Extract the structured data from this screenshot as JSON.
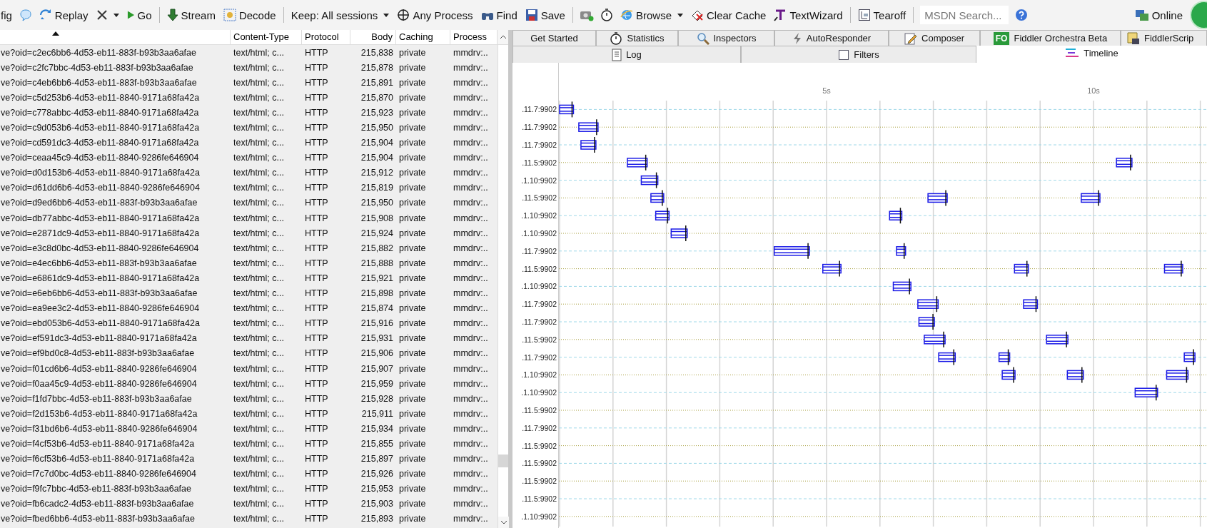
{
  "toolbar": [
    {
      "kind": "button",
      "label": "fig"
    },
    {
      "kind": "icon"
    },
    {
      "kind": "button",
      "label": "Replay"
    },
    {
      "kind": "icon",
      "has_menu": true
    },
    {
      "kind": "button",
      "label": "Go"
    },
    {
      "kind": "separator"
    },
    {
      "kind": "button",
      "label": "Stream"
    },
    {
      "kind": "button",
      "label": "Decode"
    },
    {
      "kind": "separator"
    },
    {
      "kind": "button",
      "label": "Keep: All sessions",
      "has_menu": true
    },
    {
      "kind": "button",
      "label": "Any Process"
    },
    {
      "kind": "button",
      "label": "Find"
    },
    {
      "kind": "button",
      "label": "Save"
    },
    {
      "kind": "separator"
    },
    {
      "kind": "icon"
    },
    {
      "kind": "icon"
    },
    {
      "kind": "button",
      "label": "Browse",
      "has_menu": true
    },
    {
      "kind": "button",
      "label": "Clear Cache"
    },
    {
      "kind": "button",
      "label": "TextWizard"
    },
    {
      "kind": "separator"
    },
    {
      "kind": "button",
      "label": "Tearoff"
    },
    {
      "kind": "separator"
    },
    {
      "kind": "search",
      "placeholder": "MSDN Search..."
    },
    {
      "kind": "icon"
    },
    {
      "kind": "spacer"
    },
    {
      "kind": "button",
      "label": "Online"
    }
  ],
  "sessions": {
    "columns": [
      "Content-Type",
      "Protocol",
      "Body",
      "Caching",
      "Process"
    ],
    "rows": [
      {
        "url": "ve?oid=c2ec6bb6-4d53-eb11-883f-b93b3aa6afae",
        "content_type": "text/html; c...",
        "protocol": "HTTP",
        "body": "215,838",
        "caching": "private",
        "process": "mmdrv:.."
      },
      {
        "url": "ve?oid=c2fc7bbc-4d53-eb11-883f-b93b3aa6afae",
        "content_type": "text/html; c...",
        "protocol": "HTTP",
        "body": "215,878",
        "caching": "private",
        "process": "mmdrv:.."
      },
      {
        "url": "ve?oid=c4eb6bb6-4d53-eb11-883f-b93b3aa6afae",
        "content_type": "text/html; c...",
        "protocol": "HTTP",
        "body": "215,891",
        "caching": "private",
        "process": "mmdrv:.."
      },
      {
        "url": "ve?oid=c5d253b6-4d53-eb11-8840-9171a68fa42a",
        "content_type": "text/html; c...",
        "protocol": "HTTP",
        "body": "215,870",
        "caching": "private",
        "process": "mmdrv:.."
      },
      {
        "url": "ve?oid=c778abbc-4d53-eb11-8840-9171a68fa42a",
        "content_type": "text/html; c...",
        "protocol": "HTTP",
        "body": "215,923",
        "caching": "private",
        "process": "mmdrv:.."
      },
      {
        "url": "ve?oid=c9d053b6-4d53-eb11-8840-9171a68fa42a",
        "content_type": "text/html; c...",
        "protocol": "HTTP",
        "body": "215,950",
        "caching": "private",
        "process": "mmdrv:.."
      },
      {
        "url": "ve?oid=cd591dc3-4d53-eb11-8840-9171a68fa42a",
        "content_type": "text/html; c...",
        "protocol": "HTTP",
        "body": "215,904",
        "caching": "private",
        "process": "mmdrv:.."
      },
      {
        "url": "ve?oid=ceaa45c9-4d53-eb11-8840-9286fe646904",
        "content_type": "text/html; c...",
        "protocol": "HTTP",
        "body": "215,904",
        "caching": "private",
        "process": "mmdrv:.."
      },
      {
        "url": "ve?oid=d0d153b6-4d53-eb11-8840-9171a68fa42a",
        "content_type": "text/html; c...",
        "protocol": "HTTP",
        "body": "215,912",
        "caching": "private",
        "process": "mmdrv:.."
      },
      {
        "url": "ve?oid=d61dd6b6-4d53-eb11-8840-9286fe646904",
        "content_type": "text/html; c...",
        "protocol": "HTTP",
        "body": "215,819",
        "caching": "private",
        "process": "mmdrv:.."
      },
      {
        "url": "ve?oid=d9ed6bb6-4d53-eb11-883f-b93b3aa6afae",
        "content_type": "text/html; c...",
        "protocol": "HTTP",
        "body": "215,950",
        "caching": "private",
        "process": "mmdrv:.."
      },
      {
        "url": "ve?oid=db77abbc-4d53-eb11-8840-9171a68fa42a",
        "content_type": "text/html; c...",
        "protocol": "HTTP",
        "body": "215,908",
        "caching": "private",
        "process": "mmdrv:.."
      },
      {
        "url": "ve?oid=e2871dc9-4d53-eb11-8840-9171a68fa42a",
        "content_type": "text/html; c...",
        "protocol": "HTTP",
        "body": "215,924",
        "caching": "private",
        "process": "mmdrv:.."
      },
      {
        "url": "ve?oid=e3c8d0bc-4d53-eb11-8840-9286fe646904",
        "content_type": "text/html; c...",
        "protocol": "HTTP",
        "body": "215,882",
        "caching": "private",
        "process": "mmdrv:.."
      },
      {
        "url": "ve?oid=e4ec6bb6-4d53-eb11-883f-b93b3aa6afae",
        "content_type": "text/html; c...",
        "protocol": "HTTP",
        "body": "215,888",
        "caching": "private",
        "process": "mmdrv:.."
      },
      {
        "url": "ve?oid=e6861dc9-4d53-eb11-8840-9171a68fa42a",
        "content_type": "text/html; c...",
        "protocol": "HTTP",
        "body": "215,921",
        "caching": "private",
        "process": "mmdrv:.."
      },
      {
        "url": "ve?oid=e6eb6bb6-4d53-eb11-883f-b93b3aa6afae",
        "content_type": "text/html; c...",
        "protocol": "HTTP",
        "body": "215,898",
        "caching": "private",
        "process": "mmdrv:.."
      },
      {
        "url": "ve?oid=ea9ee3c2-4d53-eb11-8840-9286fe646904",
        "content_type": "text/html; c...",
        "protocol": "HTTP",
        "body": "215,874",
        "caching": "private",
        "process": "mmdrv:.."
      },
      {
        "url": "ve?oid=ebd053b6-4d53-eb11-8840-9171a68fa42a",
        "content_type": "text/html; c...",
        "protocol": "HTTP",
        "body": "215,916",
        "caching": "private",
        "process": "mmdrv:.."
      },
      {
        "url": "ve?oid=ef591dc3-4d53-eb11-8840-9171a68fa42a",
        "content_type": "text/html; c...",
        "protocol": "HTTP",
        "body": "215,931",
        "caching": "private",
        "process": "mmdrv:.."
      },
      {
        "url": "ve?oid=ef9bd0c8-4d53-eb11-883f-b93b3aa6afae",
        "content_type": "text/html; c...",
        "protocol": "HTTP",
        "body": "215,906",
        "caching": "private",
        "process": "mmdrv:.."
      },
      {
        "url": "ve?oid=f01cd6b6-4d53-eb11-8840-9286fe646904",
        "content_type": "text/html; c...",
        "protocol": "HTTP",
        "body": "215,907",
        "caching": "private",
        "process": "mmdrv:.."
      },
      {
        "url": "ve?oid=f0aa45c9-4d53-eb11-8840-9286fe646904",
        "content_type": "text/html; c...",
        "protocol": "HTTP",
        "body": "215,959",
        "caching": "private",
        "process": "mmdrv:.."
      },
      {
        "url": "ve?oid=f1fd7bbc-4d53-eb11-883f-b93b3aa6afae",
        "content_type": "text/html; c...",
        "protocol": "HTTP",
        "body": "215,928",
        "caching": "private",
        "process": "mmdrv:.."
      },
      {
        "url": "ve?oid=f2d153b6-4d53-eb11-8840-9171a68fa42a",
        "content_type": "text/html; c...",
        "protocol": "HTTP",
        "body": "215,911",
        "caching": "private",
        "process": "mmdrv:.."
      },
      {
        "url": "ve?oid=f31bd6b6-4d53-eb11-8840-9286fe646904",
        "content_type": "text/html; c...",
        "protocol": "HTTP",
        "body": "215,934",
        "caching": "private",
        "process": "mmdrv:.."
      },
      {
        "url": "ve?oid=f4cf53b6-4d53-eb11-8840-9171a68fa42a",
        "content_type": "text/html; c...",
        "protocol": "HTTP",
        "body": "215,855",
        "caching": "private",
        "process": "mmdrv:.."
      },
      {
        "url": "ve?oid=f6cf53b6-4d53-eb11-8840-9171a68fa42a",
        "content_type": "text/html; c...",
        "protocol": "HTTP",
        "body": "215,897",
        "caching": "private",
        "process": "mmdrv:.."
      },
      {
        "url": "ve?oid=f7c7d0bc-4d53-eb11-8840-9286fe646904",
        "content_type": "text/html; c...",
        "protocol": "HTTP",
        "body": "215,926",
        "caching": "private",
        "process": "mmdrv:.."
      },
      {
        "url": "ve?oid=f9fc7bbc-4d53-eb11-883f-b93b3aa6afae",
        "content_type": "text/html; c...",
        "protocol": "HTTP",
        "body": "215,953",
        "caching": "private",
        "process": "mmdrv:.."
      },
      {
        "url": "ve?oid=fb6cadc2-4d53-eb11-883f-b93b3aa6afae",
        "content_type": "text/html; c...",
        "protocol": "HTTP",
        "body": "215,903",
        "caching": "private",
        "process": "mmdrv:.."
      },
      {
        "url": "ve?oid=fbed6bb6-4d53-eb11-883f-b93b3aa6afae",
        "content_type": "text/html; c...",
        "protocol": "HTTP",
        "body": "215,893",
        "caching": "private",
        "process": "mmdrv:.."
      }
    ]
  },
  "tabs": [
    {
      "label": "Get Started",
      "selected": false
    },
    {
      "label": "Statistics",
      "selected": false
    },
    {
      "label": "Inspectors",
      "selected": false
    },
    {
      "label": "AutoResponder",
      "selected": false
    },
    {
      "label": "Composer",
      "selected": false
    },
    {
      "label": "Fiddler Orchestra Beta",
      "badge": "FO",
      "selected": false
    },
    {
      "label": "FiddlerScrip",
      "selected": false
    }
  ],
  "subtabs": [
    {
      "label": "Log",
      "selected": false
    },
    {
      "label": "Filters",
      "selected": false
    },
    {
      "label": "Timeline",
      "selected": true
    }
  ],
  "timeline": {
    "ticks": [
      "5s",
      "10s"
    ],
    "hosts": [
      ".11.7:9902",
      ".11.7:9902",
      ".11.7:9902",
      ".11.5:9902",
      ".1.10:9902",
      ".11.5:9902",
      ".1.10:9902",
      ".1.10:9902",
      ".11.7:9902",
      ".11.5:9902",
      ".1.10:9902",
      ".11.7:9902",
      ".11.7:9902",
      ".11.5:9902",
      ".11.7:9902",
      ".1.10:9902",
      ".1.10:9902",
      ".11.5:9902",
      ".11.7:9902",
      ".11.5:9902",
      ".11.5:9902",
      ".11.5:9902",
      ".11.5:9902",
      ".1.10:9902"
    ]
  }
}
